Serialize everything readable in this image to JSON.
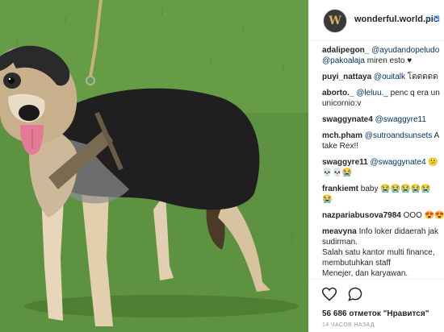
{
  "post": {
    "username": "wonderful.world.pic",
    "separator": "•",
    "follow_label": "П",
    "avatar_letter": "W"
  },
  "comments": [
    {
      "user": "adalipegon_",
      "lines": [
        [
          {
            "m": "@ayudandopeludo"
          }
        ],
        [
          {
            "m": "@pakoalaja"
          },
          {
            "t": " miren esto ♥"
          }
        ]
      ]
    },
    {
      "user": "puyi_nattaya",
      "lines": [
        [
          {
            "m": "@ouitalk"
          },
          {
            "t": " โดดดดด"
          }
        ]
      ]
    },
    {
      "user": "aborto._",
      "lines": [
        [
          {
            "m": "@leluu._"
          },
          {
            "t": " penc q era un"
          }
        ],
        [
          {
            "t": "unicornio:v"
          }
        ]
      ]
    },
    {
      "user": "swaggynate4",
      "lines": [
        [
          {
            "m": "@swaggyre11"
          }
        ]
      ]
    },
    {
      "user": "mch.pham",
      "lines": [
        [
          {
            "m": "@sutroandsunsets"
          },
          {
            "t": " A"
          }
        ],
        [
          {
            "t": "take Rex!!"
          }
        ]
      ]
    },
    {
      "user": "swaggyre11",
      "lines": [
        [
          {
            "m": "@swaggynate4"
          },
          {
            "t": " 😕"
          }
        ],
        [
          {
            "t": "💀💀😭"
          }
        ]
      ]
    },
    {
      "user": "frankiemt",
      "lines": [
        [
          {
            "t": "baby 😭😭😭😭😭"
          }
        ],
        [
          {
            "t": "😭"
          }
        ]
      ]
    },
    {
      "user": "nazpariabusova7984",
      "lines": [
        [
          {
            "t": "ООО 😍😍"
          }
        ]
      ]
    },
    {
      "user": "meavyna",
      "lines": [
        [
          {
            "t": "Info loker didaerah jak"
          }
        ],
        [
          {
            "t": "sudirman."
          }
        ],
        [
          {
            "t": "Salah satu kantor multi finance,"
          }
        ],
        [
          {
            "t": "membutuhkan staff"
          }
        ],
        [
          {
            "t": "Menejer, dan karyawan."
          }
        ]
      ]
    }
  ],
  "likes_text": "56 686 отметок \"Нравится\"",
  "timestamp": "14 ЧАСОВ НАЗАД",
  "colors": {
    "link": "#003569",
    "accent": "#3897f0",
    "text": "#262626",
    "muted": "#999999"
  },
  "icons": {
    "like": "heart-icon",
    "comment": "comment-icon"
  }
}
